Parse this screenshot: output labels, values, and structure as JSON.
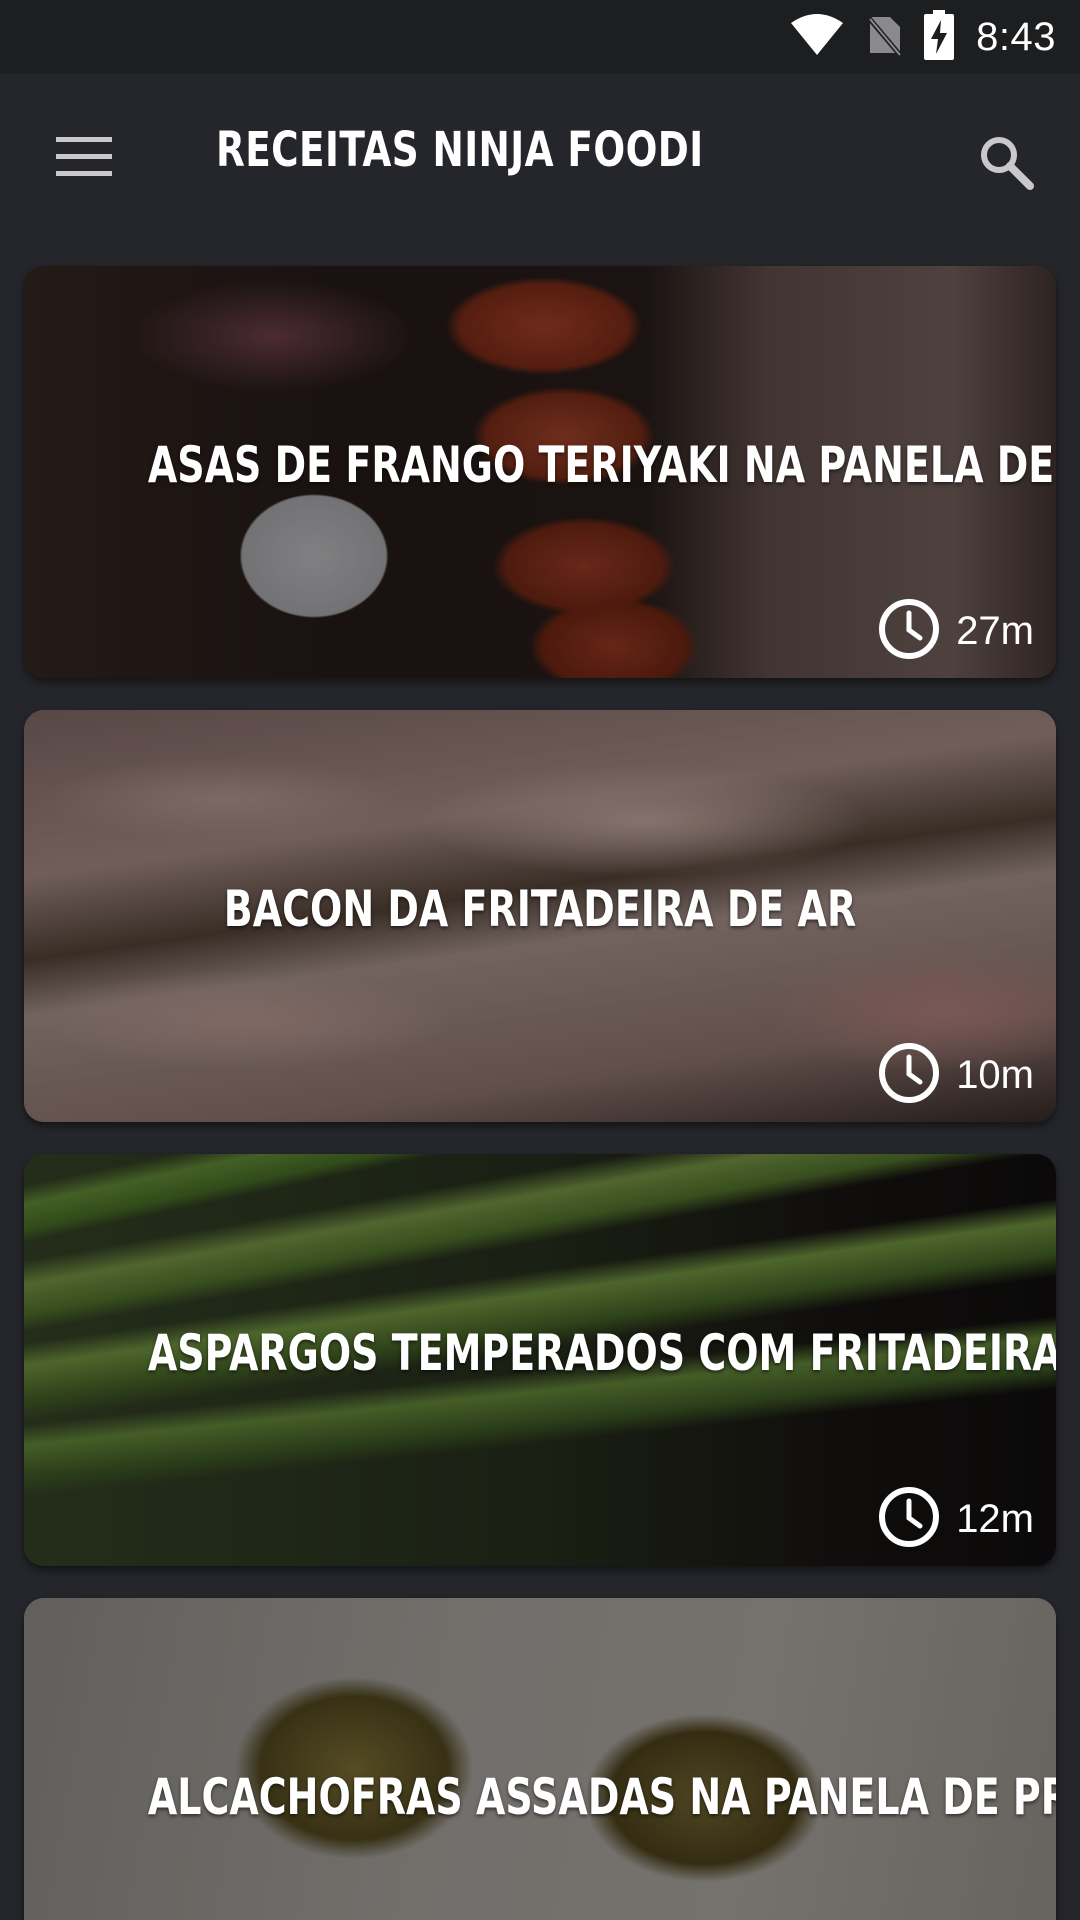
{
  "status_bar": {
    "time": "8:43",
    "icons": [
      "wifi-icon",
      "no-sim-icon",
      "battery-charging-icon"
    ]
  },
  "toolbar": {
    "title": "RECEITAS NINJA FOODI",
    "menu_icon": "hamburger-menu-icon",
    "search_icon": "search-icon"
  },
  "recipes": [
    {
      "title": "ASAS DE FRANGO TERIYAKI NA PANELA DE PRESSÃO",
      "time": "27m"
    },
    {
      "title": "BACON DA FRITADEIRA DE AR",
      "time": "10m"
    },
    {
      "title": "ASPARGOS TEMPERADOS COM FRITADEIRA DE AR",
      "time": "12m"
    },
    {
      "title": "ALCACHOFRAS ASSADAS NA PANELA DE PRESSÃO",
      "time": ""
    }
  ],
  "colors": {
    "background": "#25262b",
    "status_bar": "#1d1e20",
    "text": "#ffffff"
  }
}
